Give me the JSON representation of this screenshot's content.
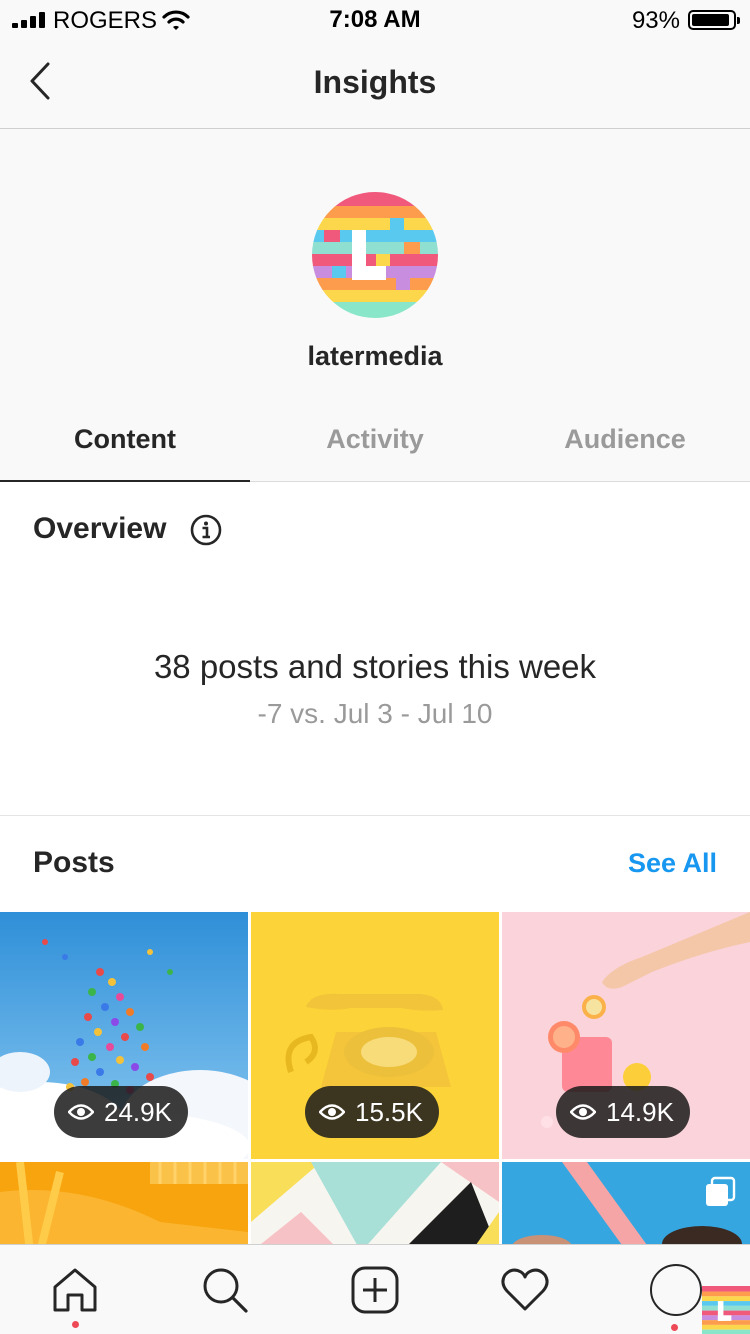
{
  "status_bar": {
    "carrier": "ROGERS",
    "time": "7:08 AM",
    "battery_percent": "93%",
    "battery_level": 0.93,
    "icons": [
      "signal-bars-icon",
      "wifi-icon",
      "battery-icon"
    ]
  },
  "header": {
    "title": "Insights",
    "back_icon": "chevron-left-icon"
  },
  "profile": {
    "username": "latermedia",
    "avatar": "latermedia-rainbow-logo"
  },
  "tabs": [
    {
      "label": "Content",
      "active": true
    },
    {
      "label": "Activity",
      "active": false
    },
    {
      "label": "Audience",
      "active": false
    }
  ],
  "overview": {
    "heading": "Overview",
    "info_icon": "info-circle-icon",
    "stat": "38 posts and stories this week",
    "comparison": "-7 vs. Jul 3 - Jul 10"
  },
  "posts": {
    "heading": "Posts",
    "see_all": "See All",
    "items": [
      {
        "subject": "balloons-in-sky",
        "views": "24.9K"
      },
      {
        "subject": "yellow-rotary-phone",
        "views": "15.5K"
      },
      {
        "subject": "grapefruit-drink",
        "views": "14.9K"
      },
      {
        "subject": "yellow-staircase",
        "views": null
      },
      {
        "subject": "colorful-triangles-wall",
        "views": null
      },
      {
        "subject": "pool-portrait",
        "views": null,
        "carousel": true
      }
    ]
  },
  "tab_bar": {
    "items": [
      "home-icon",
      "search-icon",
      "new-post-icon",
      "activity-heart-icon",
      "profile-avatar"
    ]
  },
  "colors": {
    "accent_blue": "#1797f0",
    "notification_red": "#ed4956",
    "text_primary": "#262626",
    "text_secondary": "#9a9a9a",
    "bar_background": "#f9f9f9"
  }
}
